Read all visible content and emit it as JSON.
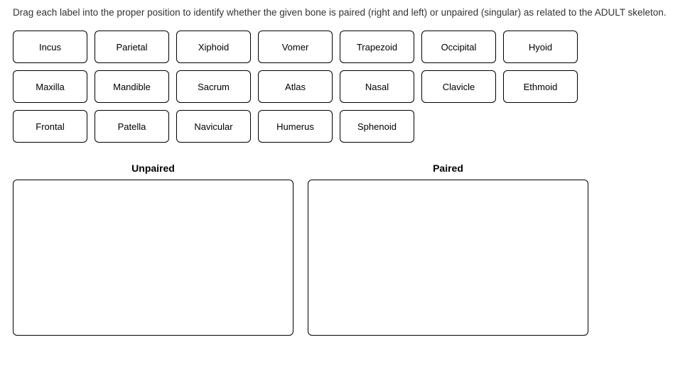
{
  "instruction": "Drag each label into the proper position to identify whether the given bone is paired (right and left) or unpaired (singular) as related to the ADULT skeleton.",
  "labels": {
    "row1": [
      "Incus",
      "Parietal",
      "Xiphoid",
      "Vomer",
      "Trapezoid",
      "Occipital",
      "Hyoid"
    ],
    "row2": [
      "Maxilla",
      "Mandible",
      "Sacrum",
      "Atlas",
      "Nasal",
      "Clavicle",
      "Ethmoid"
    ],
    "row3": [
      "Frontal",
      "Patella",
      "Navicular",
      "Humerus",
      "Sphenoid"
    ]
  },
  "dropzones": {
    "left": {
      "title": "Unpaired"
    },
    "right": {
      "title": "Paired"
    }
  }
}
